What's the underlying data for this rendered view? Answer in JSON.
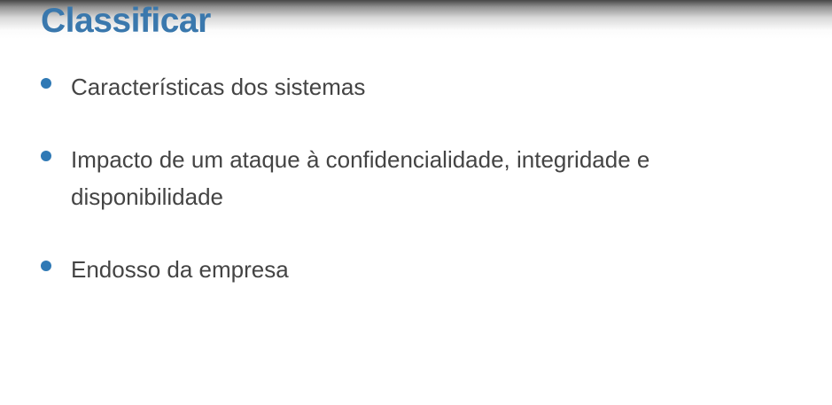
{
  "slide": {
    "title": "Classificar",
    "bullets": [
      {
        "text": "Características dos sistemas"
      },
      {
        "text": "Impacto de um ataque à confidencialidade, integridade e disponibilidade"
      },
      {
        "text": "Endosso da empresa"
      }
    ]
  },
  "colors": {
    "title": "#3a78ad",
    "bullet_dot": "#2f79b5",
    "body_text": "#444444",
    "background": "#ffffff"
  }
}
